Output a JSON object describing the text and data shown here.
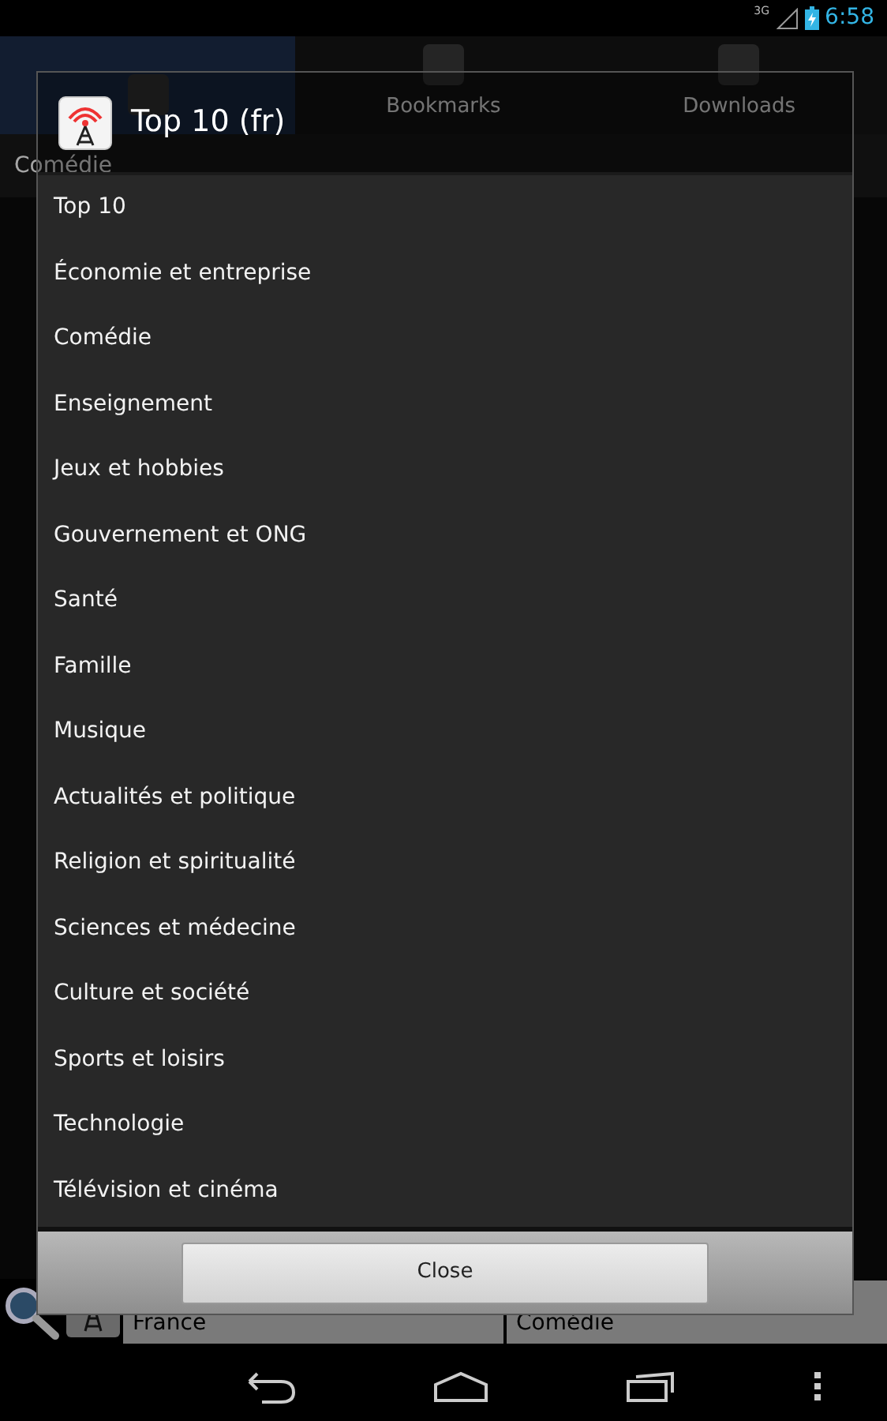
{
  "status_bar": {
    "network": "3G",
    "time": "6:58"
  },
  "tabs": [
    {
      "selected": true
    },
    {
      "label": "Bookmarks",
      "selected": false
    },
    {
      "label": "Downloads",
      "selected": false
    }
  ],
  "category_bar": {
    "label": "Comédie"
  },
  "dialog": {
    "title": "Top 10 (fr)",
    "items": [
      "Top 10",
      "Économie et entreprise",
      "Comédie",
      "Enseignement",
      "Jeux et hobbies",
      "Gouvernement et ONG",
      "Santé",
      "Famille",
      "Musique",
      "Actualités et politique",
      "Religion et spiritualité",
      "Sciences et médecine",
      "Culture et société",
      "Sports et loisirs",
      "Technologie",
      "Télévision et cinéma"
    ],
    "button": "Close"
  },
  "filter_bar": {
    "country": "France",
    "category": "Comédie"
  }
}
